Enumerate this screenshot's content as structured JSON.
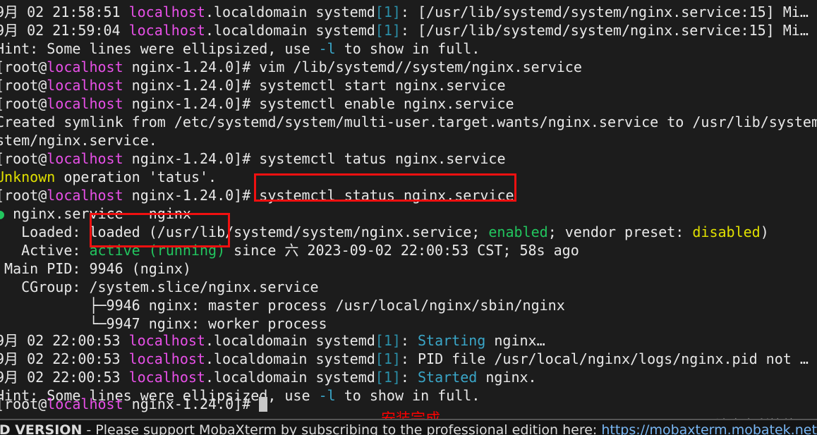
{
  "terminal": {
    "prompt_user": "root@",
    "prompt_host": "localhost",
    "prompt_tail": " nginx-1.24.0]# ",
    "lines": [
      {
        "id": "log-1",
        "segments": [
          {
            "text": "9月 02 21:58:51 ",
            "color": "w"
          },
          {
            "text": "localhost",
            "color": "mag"
          },
          {
            "text": ".localdomain systemd",
            "color": "w"
          },
          {
            "text": "[1]",
            "color": "cyn"
          },
          {
            "text": ": [/usr/lib/systemd/system/nginx.service:15] Mi…",
            "color": "w"
          }
        ]
      },
      {
        "id": "log-2",
        "segments": [
          {
            "text": "9月 02 21:59:04 ",
            "color": "w"
          },
          {
            "text": "localhost",
            "color": "mag"
          },
          {
            "text": ".localdomain systemd",
            "color": "w"
          },
          {
            "text": "[1]",
            "color": "cyn"
          },
          {
            "text": ": [/usr/lib/systemd/system/nginx.service:15] Mi…",
            "color": "w"
          }
        ]
      },
      {
        "id": "hint-1",
        "segments": [
          {
            "text": "Hint: Some lines were ellipsized, use ",
            "color": "w"
          },
          {
            "text": "-l",
            "color": "cy2"
          },
          {
            "text": " to show in full.",
            "color": "w"
          }
        ]
      },
      {
        "id": "cmd-vim",
        "segments": [
          {
            "text": "[",
            "color": "w"
          },
          {
            "text": "root@",
            "color": "w"
          },
          {
            "text": "localhost",
            "color": "mag"
          },
          {
            "text": " nginx-1.24.0]# vim /lib/systemd//system/nginx.service",
            "color": "w"
          }
        ]
      },
      {
        "id": "cmd-start",
        "segments": [
          {
            "text": "[",
            "color": "w"
          },
          {
            "text": "root@",
            "color": "w"
          },
          {
            "text": "localhost",
            "color": "mag"
          },
          {
            "text": " nginx-1.24.0]# systemctl start nginx.service",
            "color": "w"
          }
        ]
      },
      {
        "id": "cmd-enable",
        "segments": [
          {
            "text": "[",
            "color": "w"
          },
          {
            "text": "root@",
            "color": "w"
          },
          {
            "text": "localhost",
            "color": "mag"
          },
          {
            "text": " nginx-1.24.0]# systemctl enable nginx.service",
            "color": "w"
          }
        ]
      },
      {
        "id": "out-symlink-1",
        "segments": [
          {
            "text": "Created symlink from /etc/systemd/system/multi-user.target.wants/nginx.service to /usr/lib/system",
            "color": "w"
          }
        ]
      },
      {
        "id": "out-symlink-2",
        "segments": [
          {
            "text": "stem/nginx.service.",
            "color": "w"
          }
        ]
      },
      {
        "id": "cmd-tatus",
        "segments": [
          {
            "text": "[",
            "color": "w"
          },
          {
            "text": "root@",
            "color": "w"
          },
          {
            "text": "localhost",
            "color": "mag"
          },
          {
            "text": " nginx-1.24.0]# systemctl tatus nginx.service",
            "color": "w"
          }
        ]
      },
      {
        "id": "out-unknown",
        "segments": [
          {
            "text": "Unknown",
            "color": "yel"
          },
          {
            "text": " operation 'tatus'.",
            "color": "w"
          }
        ]
      },
      {
        "id": "cmd-status",
        "segments": [
          {
            "text": "[",
            "color": "w"
          },
          {
            "text": "root@",
            "color": "w"
          },
          {
            "text": "localhost",
            "color": "mag"
          },
          {
            "text": " nginx-1.24.0]# systemctl status nginx.service",
            "color": "w"
          }
        ]
      },
      {
        "id": "svc-header",
        "segments": [
          {
            "text": "●",
            "color": "grn"
          },
          {
            "text": " nginx.service - nginx",
            "color": "w"
          }
        ]
      },
      {
        "id": "svc-loaded",
        "segments": [
          {
            "text": "   Loaded: loaded (/usr/lib/systemd/system/nginx.service; ",
            "color": "w"
          },
          {
            "text": "enabled",
            "color": "grn"
          },
          {
            "text": "; vendor preset: ",
            "color": "w"
          },
          {
            "text": "disabled",
            "color": "yel"
          },
          {
            "text": ")",
            "color": "w"
          }
        ]
      },
      {
        "id": "svc-active",
        "segments": [
          {
            "text": "   Active: ",
            "color": "w"
          },
          {
            "text": "active (running)",
            "color": "grn"
          },
          {
            "text": " since 六 2023-09-02 22:00:53 CST; 58s ago",
            "color": "w"
          }
        ]
      },
      {
        "id": "svc-mainpid",
        "segments": [
          {
            "text": " Main PID: 9946 (nginx)",
            "color": "w"
          }
        ]
      },
      {
        "id": "svc-cgroup",
        "segments": [
          {
            "text": "   CGroup: /system.slice/nginx.service",
            "color": "w"
          }
        ]
      },
      {
        "id": "svc-proc-master",
        "segments": [
          {
            "text": "           ├─9946 nginx: master process /usr/local/nginx/sbin/nginx",
            "color": "w"
          }
        ]
      },
      {
        "id": "svc-proc-worker",
        "segments": [
          {
            "text": "           └─9947 nginx: worker process",
            "color": "w"
          }
        ]
      },
      {
        "id": "log-starting",
        "segments": [
          {
            "text": "9月 02 22:00:53 ",
            "color": "w"
          },
          {
            "text": "localhost",
            "color": "mag"
          },
          {
            "text": ".localdomain systemd",
            "color": "w"
          },
          {
            "text": "[1]",
            "color": "cyn"
          },
          {
            "text": ": ",
            "color": "w"
          },
          {
            "text": "Starting",
            "color": "cy2"
          },
          {
            "text": " nginx…",
            "color": "w"
          }
        ]
      },
      {
        "id": "log-pidfile",
        "segments": [
          {
            "text": "9月 02 22:00:53 ",
            "color": "w"
          },
          {
            "text": "localhost",
            "color": "mag"
          },
          {
            "text": ".localdomain systemd",
            "color": "w"
          },
          {
            "text": "[1]",
            "color": "cyn"
          },
          {
            "text": ": PID file /usr/local/nginx/logs/nginx.pid not …",
            "color": "w"
          }
        ]
      },
      {
        "id": "log-started",
        "segments": [
          {
            "text": "9月 02 22:00:53 ",
            "color": "w"
          },
          {
            "text": "localhost",
            "color": "mag"
          },
          {
            "text": ".localdomain systemd",
            "color": "w"
          },
          {
            "text": "[1]",
            "color": "cyn"
          },
          {
            "text": ": ",
            "color": "w"
          },
          {
            "text": "Started",
            "color": "cy2"
          },
          {
            "text": " nginx.",
            "color": "w"
          }
        ]
      },
      {
        "id": "hint-2",
        "segments": [
          {
            "text": "Hint: Some lines were ellipsized, use ",
            "color": "w"
          },
          {
            "text": "-l",
            "color": "cy2"
          },
          {
            "text": " to show in full.",
            "color": "w"
          }
        ]
      }
    ],
    "final_prompt": {
      "segments": [
        {
          "text": "[",
          "color": "w"
        },
        {
          "text": "root@",
          "color": "w"
        },
        {
          "text": "localhost",
          "color": "mag"
        },
        {
          "text": " nginx-1.24.0]# ",
          "color": "w"
        }
      ]
    }
  },
  "annotations": {
    "box_command_label": "systemctl status nginx.service",
    "box_status_label": "loaded / active (running)",
    "install_complete_text": "安装完成",
    "box_color": "#f01010",
    "text_color": "#ff0000"
  },
  "watermark": {
    "text": "CSDN @达米安利拉德",
    "color": "#8d8d8d"
  },
  "statusbar": {
    "prefix": "UNREGISTERED VERSION",
    "middle": " - Please support MobaXterm by subscribing to the professional edition here:  ",
    "link": "https://mobaxterm.mobatek.net"
  }
}
